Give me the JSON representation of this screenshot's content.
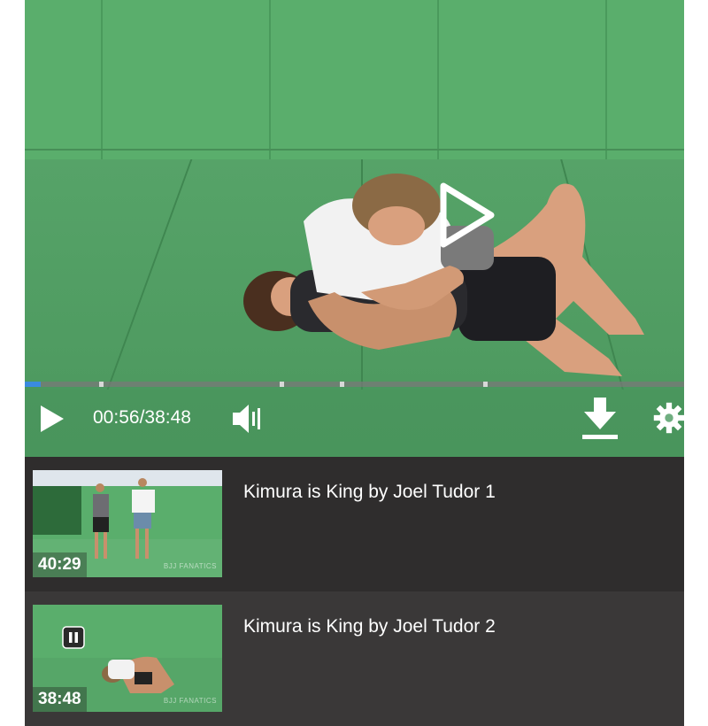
{
  "player": {
    "current_time": "00:56",
    "separator": "/",
    "duration": "38:48",
    "progress_fraction": 0.024,
    "chapter_markers": [
      0.113,
      0.386,
      0.478,
      0.695
    ],
    "icons": {
      "big_play": "play-icon",
      "play": "play-icon",
      "volume": "volume-icon",
      "download": "download-icon",
      "settings": "gear-icon"
    },
    "colors": {
      "progress": "#3a8be0",
      "accent": "#ffffff"
    }
  },
  "playlist": {
    "items": [
      {
        "title": "Kimura is King by Joel Tudor 1",
        "duration": "40:29",
        "watermark": "BJJ FANATICS",
        "selected": false
      },
      {
        "title": "Kimura is King by Joel Tudor 2",
        "duration": "38:48",
        "watermark": "BJJ FANATICS",
        "selected": true
      }
    ]
  }
}
